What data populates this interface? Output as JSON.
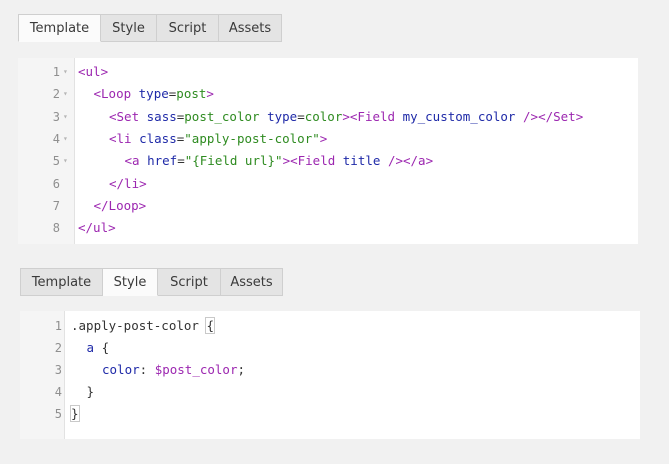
{
  "tabs_top": [
    "Template",
    "Style",
    "Script",
    "Assets"
  ],
  "tabs_bottom": [
    "Template",
    "Style",
    "Script",
    "Assets"
  ],
  "editor_template": {
    "lines": [
      {
        "n": "1",
        "fold": "▾",
        "indent": 0,
        "parts": [
          [
            "tag",
            "<ul>"
          ]
        ]
      },
      {
        "n": "2",
        "fold": "▾",
        "indent": 1,
        "parts": [
          [
            "tag",
            "<Loop "
          ],
          [
            "attr",
            "type"
          ],
          [
            "plain",
            "="
          ],
          [
            "val",
            "post"
          ],
          [
            "tag",
            ">"
          ]
        ]
      },
      {
        "n": "3",
        "fold": "▾",
        "indent": 2,
        "parts": [
          [
            "tag",
            "<Set "
          ],
          [
            "attr",
            "sass"
          ],
          [
            "plain",
            "="
          ],
          [
            "val",
            "post_color "
          ],
          [
            "attr",
            "type"
          ],
          [
            "plain",
            "="
          ],
          [
            "val",
            "color"
          ],
          [
            "tag",
            ">"
          ],
          [
            "tag",
            "<Field "
          ],
          [
            "attr",
            "my_custom_color "
          ],
          [
            "tag",
            "/>"
          ],
          [
            "tag",
            "</Set>"
          ]
        ]
      },
      {
        "n": "4",
        "fold": "▾",
        "indent": 2,
        "parts": [
          [
            "tag",
            "<li "
          ],
          [
            "attr",
            "class"
          ],
          [
            "plain",
            "="
          ],
          [
            "val",
            "\"apply-post-color\""
          ],
          [
            "tag",
            ">"
          ]
        ]
      },
      {
        "n": "5",
        "fold": "▾",
        "indent": 3,
        "parts": [
          [
            "tag",
            "<a "
          ],
          [
            "attr",
            "href"
          ],
          [
            "plain",
            "="
          ],
          [
            "val",
            "\"{Field url}\""
          ],
          [
            "tag",
            ">"
          ],
          [
            "tag",
            "<Field "
          ],
          [
            "attr",
            "title "
          ],
          [
            "tag",
            "/>"
          ],
          [
            "tag",
            "</a>"
          ]
        ]
      },
      {
        "n": "6",
        "fold": "",
        "indent": 2,
        "parts": [
          [
            "tag",
            "</li>"
          ]
        ]
      },
      {
        "n": "7",
        "fold": "",
        "indent": 1,
        "parts": [
          [
            "tag",
            "</Loop>"
          ]
        ]
      },
      {
        "n": "8",
        "fold": "",
        "indent": 0,
        "parts": [
          [
            "tag",
            "</ul>"
          ]
        ]
      }
    ]
  },
  "editor_style": {
    "lines": [
      {
        "n": "1",
        "indent": 0,
        "parts": [
          [
            "plain",
            ".apply-post-color "
          ],
          [
            "brace",
            "{"
          ]
        ]
      },
      {
        "n": "2",
        "indent": 1,
        "parts": [
          [
            "prop",
            "a "
          ],
          [
            "plain",
            "{"
          ]
        ]
      },
      {
        "n": "3",
        "indent": 2,
        "parts": [
          [
            "prop",
            "color"
          ],
          [
            "plain",
            ": "
          ],
          [
            "var",
            "$post_color"
          ],
          [
            "plain",
            ";"
          ]
        ]
      },
      {
        "n": "4",
        "indent": 1,
        "parts": [
          [
            "plain",
            "}"
          ]
        ]
      },
      {
        "n": "5",
        "indent": 0,
        "parts": [
          [
            "brace",
            "}"
          ]
        ]
      }
    ]
  }
}
